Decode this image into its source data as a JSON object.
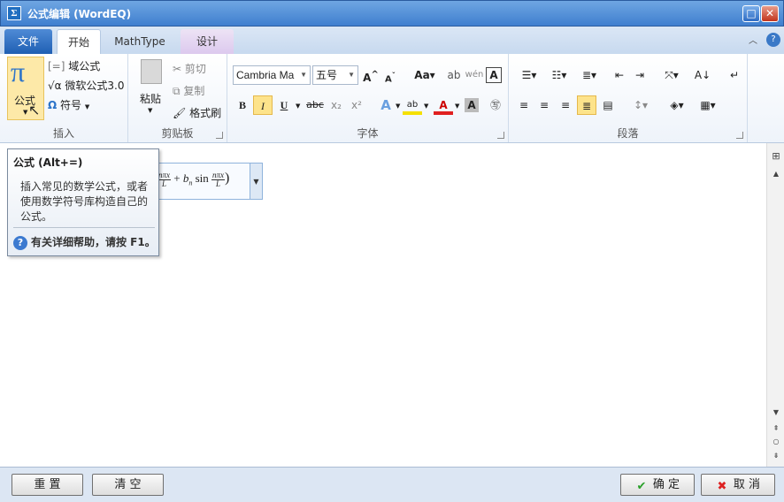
{
  "window": {
    "title": "公式编辑 (WordEQ)",
    "icon": "app-icon"
  },
  "tabs": {
    "file": "文件",
    "home": "开始",
    "mathtype": "MathType",
    "design": "设计"
  },
  "ribbon": {
    "insert": {
      "equation_label": "公式",
      "field_equation": "域公式",
      "ms_equation": "微软公式3.0",
      "symbol": "符号",
      "group_label": "插入"
    },
    "clipboard": {
      "paste": "粘贴",
      "cut": "剪切",
      "copy": "复制",
      "format_painter": "格式刷",
      "group_label": "剪贴板"
    },
    "font": {
      "font_name": "Cambria Ma",
      "font_size": "五号",
      "bold": "B",
      "italic": "I",
      "underline": "U",
      "strike": "abc",
      "subscript": "x₂",
      "superscript": "x²",
      "group_label": "字体"
    },
    "paragraph": {
      "group_label": "段落"
    }
  },
  "tooltip": {
    "title": "公式 (Alt+=)",
    "body": "插入常见的数学公式，或者使用数学符号库构造自己的公式。",
    "help": "有关详细帮助，请按 F1。"
  },
  "equation_preview": "nπx/L + bn sin nπx/L",
  "buttons": {
    "reset": "重 置",
    "clear": "清 空",
    "ok": "确 定",
    "cancel": "取 消"
  },
  "colors": {
    "accent": "#2b6cc4",
    "highlight": "#fde38b",
    "font_color": "#e02020",
    "highlight_color": "#f5e000"
  }
}
